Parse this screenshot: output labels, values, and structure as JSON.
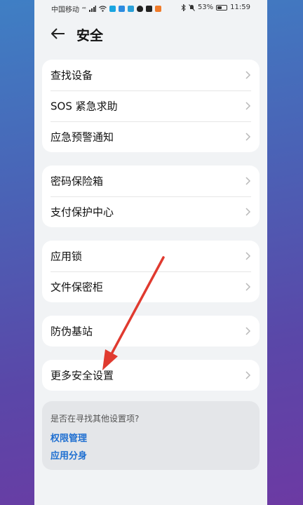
{
  "status_bar": {
    "carrier": "中国移动",
    "signal": "⁴⁶",
    "battery": "53%",
    "battery_level": 0.53,
    "time": "11:59"
  },
  "header": {
    "title": "安全"
  },
  "groups": [
    {
      "items": [
        {
          "label": "查找设备"
        },
        {
          "label": "SOS 紧急求助"
        },
        {
          "label": "应急预警通知"
        }
      ]
    },
    {
      "items": [
        {
          "label": "密码保险箱"
        },
        {
          "label": "支付保护中心"
        }
      ]
    },
    {
      "items": [
        {
          "label": "应用锁"
        },
        {
          "label": "文件保密柜"
        }
      ]
    },
    {
      "items": [
        {
          "label": "防伪基站"
        }
      ]
    },
    {
      "items": [
        {
          "label": "更多安全设置"
        }
      ]
    }
  ],
  "suggestions": {
    "question": "是否在寻找其他设置项?",
    "links": [
      {
        "label": "权限管理"
      },
      {
        "label": "应用分身"
      }
    ]
  },
  "colors": {
    "accent": "#1f6fd1",
    "annotation_arrow": "#e03a2f"
  }
}
